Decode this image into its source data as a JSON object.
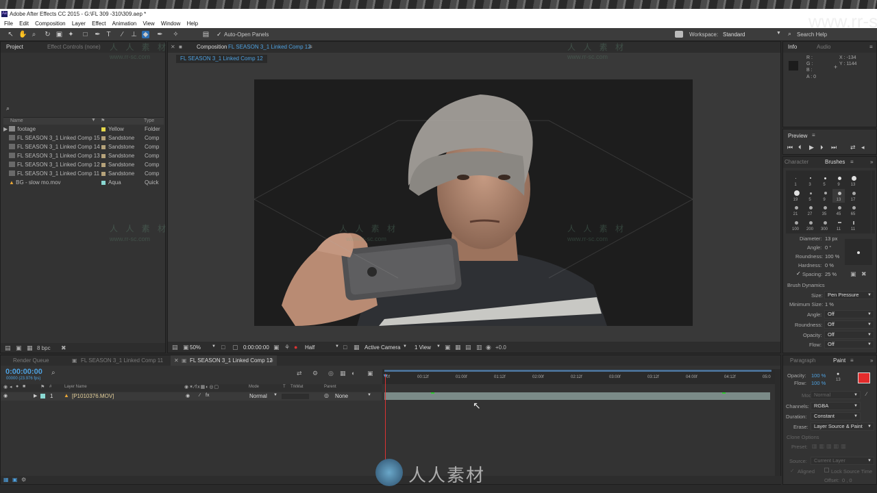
{
  "window": {
    "title": "Adobe After Effects CC 2015 - G:\\FL 309 -310\\309.aep *",
    "app_badge": "Ae"
  },
  "menu": [
    "File",
    "Edit",
    "Composition",
    "Layer",
    "Effect",
    "Animation",
    "View",
    "Window",
    "Help"
  ],
  "toolbar": {
    "auto_open": "Auto-Open Panels",
    "workspace_label": "Workspace:",
    "workspace_value": "Standard",
    "search_help": "Search Help"
  },
  "watermark": {
    "url": "www.rr-sc.com",
    "cn": "人 人 素 材",
    "bottom_cn": "人人素材"
  },
  "project": {
    "tab_project": "Project",
    "tab_effects": "Effect Controls (none)",
    "search_icon": "⌕",
    "col_name": "Name",
    "col_type": "Type",
    "items": [
      {
        "name": "footage",
        "label": "Yellow",
        "type": "Folder",
        "color": "#e6d94b"
      },
      {
        "name": "FL SEASON 3_1 Linked Comp 15",
        "label": "Sandstone",
        "type": "Comp",
        "color": "#b5a27a"
      },
      {
        "name": "FL SEASON 3_1 Linked Comp 14",
        "label": "Sandstone",
        "type": "Comp",
        "color": "#b5a27a"
      },
      {
        "name": "FL SEASON 3_1 Linked Comp 13",
        "label": "Sandstone",
        "type": "Comp",
        "color": "#b5a27a"
      },
      {
        "name": "FL SEASON 3_1 Linked Comp 12",
        "label": "Sandstone",
        "type": "Comp",
        "color": "#b5a27a"
      },
      {
        "name": "FL SEASON 3_1 Linked Comp 11",
        "label": "Sandstone",
        "type": "Comp",
        "color": "#b5a27a"
      },
      {
        "name": "BG - slow mo.mov",
        "label": "Aqua",
        "type": "Quick",
        "color": "#8ad8d2"
      }
    ],
    "bpc": "8 bpc"
  },
  "composition": {
    "panel_label": "Composition",
    "comp_name": "FL SEASON 3_1 Linked Comp 12",
    "sub_tab": "FL SEASON 3_1 Linked Comp 12",
    "zoom": "50%",
    "timecode": "0:00:00:00",
    "resolution": "Half",
    "camera": "Active Camera",
    "view": "1 View",
    "exposure": "+0.0"
  },
  "info": {
    "tab_info": "Info",
    "tab_audio": "Audio",
    "r": "R :",
    "g": "G :",
    "b": "B :",
    "a": "A : 0",
    "x": "X : -134",
    "y": "Y : 1144"
  },
  "preview": {
    "title": "Preview"
  },
  "brushes": {
    "tab_character": "Character",
    "tab_brushes": "Brushes",
    "sizes": [
      "1",
      "3",
      "5",
      "9",
      "13",
      "19",
      "5",
      "9",
      "13",
      "17",
      "21",
      "27",
      "35",
      "45",
      "65",
      "100",
      "200",
      "300",
      "11",
      "11"
    ],
    "diameter_label": "Diameter:",
    "diameter": "13 px",
    "angle_label": "Angle:",
    "angle": "0 °",
    "roundness_label": "Roundness:",
    "roundness": "100 %",
    "hardness_label": "Hardness:",
    "hardness": "0 %",
    "spacing_label": "Spacing:",
    "spacing": "25 %",
    "dynamics_title": "Brush Dynamics",
    "size_label": "Size:",
    "size": "Pen Pressure",
    "minsize_label": "Minimum Size:",
    "minsize": "1 %",
    "dyn_angle_label": "Angle:",
    "dyn_angle": "Off",
    "dyn_round_label": "Roundness:",
    "dyn_round": "Off",
    "opacity_label": "Opacity:",
    "opacity": "Off",
    "flow_label": "Flow:",
    "flow": "Off"
  },
  "paint": {
    "tab_paragraph": "Paragraph",
    "tab_paint": "Paint",
    "opacity_label": "Opacity:",
    "opacity": "100 %",
    "flow_label": "Flow:",
    "flow": "100 %",
    "brush_size": "13",
    "fg_color": "#e32b2b",
    "mode_label": "Mode:",
    "mode": "Normal",
    "channels_label": "Channels:",
    "channels": "RGBA",
    "duration_label": "Duration:",
    "duration": "Constant",
    "erase_label": "Erase:",
    "erase": "Layer Source & Paint",
    "clone_title": "Clone Options",
    "preset_label": "Preset:",
    "source_label": "Source:",
    "source": "Current Layer",
    "aligned": "Aligned",
    "lock_source": "Lock Source Time",
    "offset_label": "Offset:",
    "offset": "0 , 0"
  },
  "timeline": {
    "tab_render": "Render Queue",
    "tab_comp11": "FL SEASON 3_1 Linked Comp 11",
    "tab_comp12": "FL SEASON 3_1 Linked Comp 12",
    "timecode": "0:00:00:00",
    "fps": "00000 (23.976 fps)",
    "col_num": "#",
    "col_layer": "Layer Name",
    "col_mode": "Mode",
    "col_t": "T",
    "col_trkmat": "TrkMat",
    "col_parent": "Parent",
    "ruler": [
      "0f",
      "00:12f",
      "01:00f",
      "01:12f",
      "02:00f",
      "02:12f",
      "03:00f",
      "03:12f",
      "04:00f",
      "04:12f",
      "05:0"
    ],
    "layer": {
      "num": "1",
      "name": "[P1010376.MOV]",
      "mode": "Normal",
      "parent": "None"
    }
  }
}
